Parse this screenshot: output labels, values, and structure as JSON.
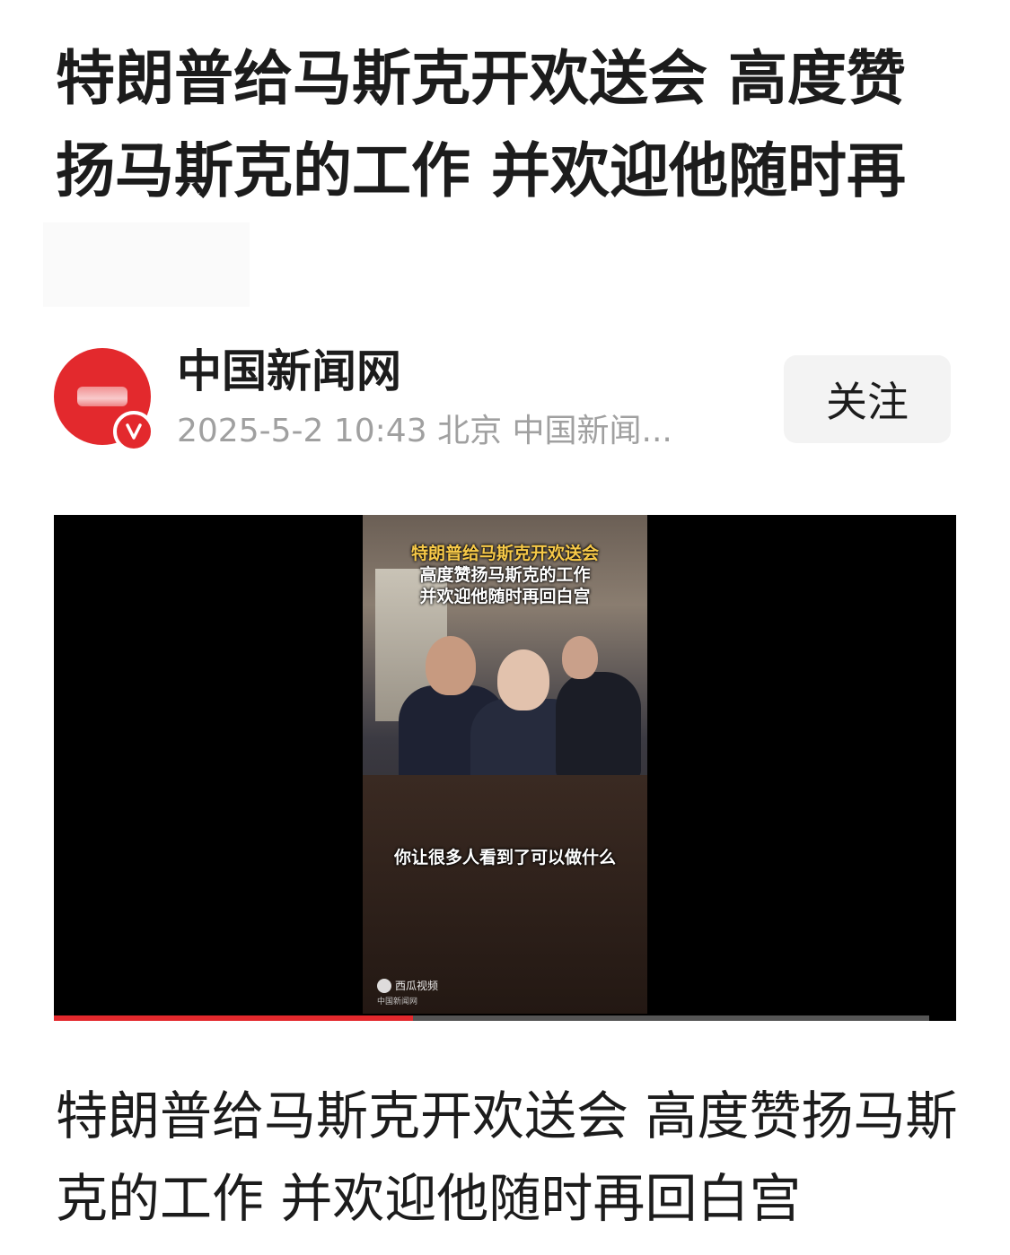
{
  "article": {
    "headline": "特朗普给马斯克开欢送会 高度赞扬马斯克的工作 并欢迎他随时再",
    "body_text": "特朗普给马斯克开欢送会 高度赞扬马斯克的工作 并欢迎他随时再回白宫"
  },
  "author": {
    "name": "中国新闻网",
    "date": "2025-5-2",
    "time": "10:43",
    "location": "北京",
    "source": "中国新闻...",
    "verified_icon": "verified-v-icon",
    "follow_label": "关注"
  },
  "video": {
    "title_line1": "特朗普给马斯克开欢送会",
    "title_line2": "高度赞扬马斯克的工作",
    "title_line3": "并欢迎他随时再回白宫",
    "subtitle": "你让很多人看到了可以做什么",
    "watermark": "西瓜视频",
    "watermark_sub": "中国新闻网",
    "progress": 0.41
  },
  "colors": {
    "accent_red": "#e3292d",
    "caption_yellow": "#f7c948",
    "meta_gray": "#a0a0a0"
  }
}
